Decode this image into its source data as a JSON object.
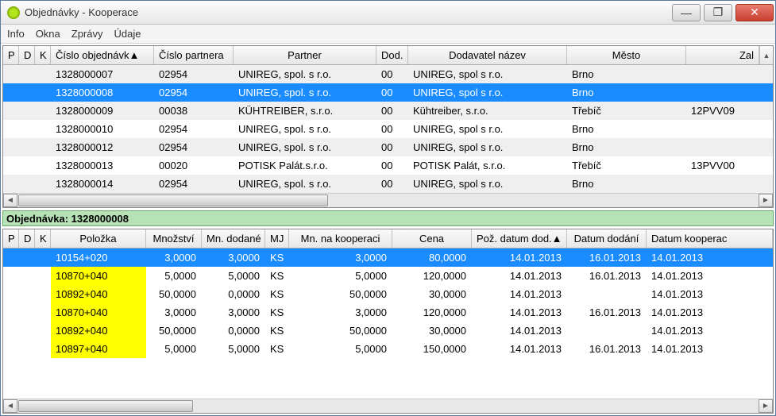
{
  "window": {
    "title": "Objednávky - Kooperace"
  },
  "winButtons": {
    "min": "—",
    "max": "❐",
    "close": "✕"
  },
  "menu": {
    "info": "Info",
    "okna": "Okna",
    "zpravy": "Zprávy",
    "udaje": "Údaje"
  },
  "grid1": {
    "headers": {
      "p": "P",
      "d": "D",
      "k": "K",
      "cisloObj": "Číslo objednávk▲",
      "cisloPart": "Číslo partnera",
      "partner": "Partner",
      "dod": "Dod.",
      "dodavatel": "Dodavatel název",
      "mesto": "Město",
      "zal": "Zal"
    },
    "rows": [
      {
        "co": "1328000007",
        "cp": "02954",
        "partner": "UNIREG, spol. s r.o.",
        "dod": "00",
        "dn": "UNIREG, spol s r.o.",
        "mesto": "Brno",
        "zal": "",
        "alt": true,
        "sel": false
      },
      {
        "co": "1328000008",
        "cp": "02954",
        "partner": "UNIREG, spol. s r.o.",
        "dod": "00",
        "dn": "UNIREG, spol s r.o.",
        "mesto": "Brno",
        "zal": "",
        "alt": false,
        "sel": true
      },
      {
        "co": "1328000009",
        "cp": "00038",
        "partner": "KÜHTREIBER, s.r.o.",
        "dod": "00",
        "dn": "Kühtreiber, s.r.o.",
        "mesto": "Třebíč",
        "zal": "12PVV09",
        "alt": true,
        "sel": false
      },
      {
        "co": "1328000010",
        "cp": "02954",
        "partner": "UNIREG, spol. s r.o.",
        "dod": "00",
        "dn": "UNIREG, spol s r.o.",
        "mesto": "Brno",
        "zal": "",
        "alt": false,
        "sel": false
      },
      {
        "co": "1328000012",
        "cp": "02954",
        "partner": "UNIREG, spol. s r.o.",
        "dod": "00",
        "dn": "UNIREG, spol s r.o.",
        "mesto": "Brno",
        "zal": "",
        "alt": true,
        "sel": false
      },
      {
        "co": "1328000013",
        "cp": "00020",
        "partner": "POTISK Palát.s.r.o.",
        "dod": "00",
        "dn": "POTISK Palát, s.r.o.",
        "mesto": "Třebíč",
        "zal": "13PVV00",
        "alt": false,
        "sel": false
      },
      {
        "co": "1328000014",
        "cp": "02954",
        "partner": "UNIREG, spol. s r.o.",
        "dod": "00",
        "dn": "UNIREG, spol s r.o.",
        "mesto": "Brno",
        "zal": "",
        "alt": true,
        "sel": false
      }
    ]
  },
  "divider": {
    "label": "Objednávka:",
    "value": "1328000008"
  },
  "grid2": {
    "headers": {
      "p": "P",
      "d": "D",
      "k": "K",
      "polozka": "Položka",
      "mnozstvi": "Množství",
      "dodane": "Mn. dodané",
      "mj": "MJ",
      "koop": "Mn. na kooperaci",
      "cena": "Cena",
      "pozdat": "Pož. datum dod.▲",
      "datdod": "Datum dodání",
      "datkoop": "Datum kooperac"
    },
    "rows": [
      {
        "pol": "10154+020",
        "mn": "3,0000",
        "dd": "3,0000",
        "mj": "KS",
        "mk": "3,0000",
        "cena": "80,0000",
        "pd": "14.01.2013",
        "dat": "16.01.2013",
        "dk": "14.01.2013",
        "sel": true,
        "yel": false
      },
      {
        "pol": "10870+040",
        "mn": "5,0000",
        "dd": "5,0000",
        "mj": "KS",
        "mk": "5,0000",
        "cena": "120,0000",
        "pd": "14.01.2013",
        "dat": "16.01.2013",
        "dk": "14.01.2013",
        "sel": false,
        "yel": true
      },
      {
        "pol": "10892+040",
        "mn": "50,0000",
        "dd": "0,0000",
        "mj": "KS",
        "mk": "50,0000",
        "cena": "30,0000",
        "pd": "14.01.2013",
        "dat": "",
        "dk": "14.01.2013",
        "sel": false,
        "yel": true
      },
      {
        "pol": "10870+040",
        "mn": "3,0000",
        "dd": "3,0000",
        "mj": "KS",
        "mk": "3,0000",
        "cena": "120,0000",
        "pd": "14.01.2013",
        "dat": "16.01.2013",
        "dk": "14.01.2013",
        "sel": false,
        "yel": true
      },
      {
        "pol": "10892+040",
        "mn": "50,0000",
        "dd": "0,0000",
        "mj": "KS",
        "mk": "50,0000",
        "cena": "30,0000",
        "pd": "14.01.2013",
        "dat": "",
        "dk": "14.01.2013",
        "sel": false,
        "yel": true
      },
      {
        "pol": "10897+040",
        "mn": "5,0000",
        "dd": "5,0000",
        "mj": "KS",
        "mk": "5,0000",
        "cena": "150,0000",
        "pd": "14.01.2013",
        "dat": "16.01.2013",
        "dk": "14.01.2013",
        "sel": false,
        "yel": true
      }
    ]
  },
  "scrollArrows": {
    "left": "◄",
    "right": "►",
    "up": "▲"
  }
}
